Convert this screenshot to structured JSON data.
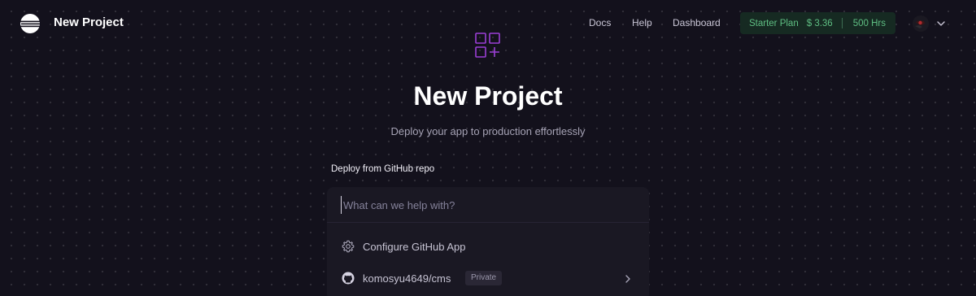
{
  "header": {
    "title": "New Project",
    "nav": {
      "docs": "Docs",
      "help": "Help",
      "dashboard": "Dashboard"
    },
    "plan": {
      "name": "Starter Plan",
      "credit": "$ 3.36",
      "hours": "500 Hrs"
    }
  },
  "hero": {
    "title": "New Project",
    "subtitle": "Deploy your app to production effortlessly",
    "icon": "grid-plus-icon"
  },
  "deploy": {
    "label": "Deploy from GitHub repo",
    "search_placeholder": "What can we help with?",
    "items": [
      {
        "label": "Configure GitHub App",
        "icon": "gear-icon"
      },
      {
        "label": "komosyu4649/cms",
        "badge": "Private",
        "icon": "github-icon"
      }
    ]
  },
  "colors": {
    "background": "#13111c",
    "accent": "#9b3fd6",
    "plan_badge_text": "#5fbf83",
    "plan_badge_bg": "#162a22",
    "panel": "#1a1823"
  }
}
